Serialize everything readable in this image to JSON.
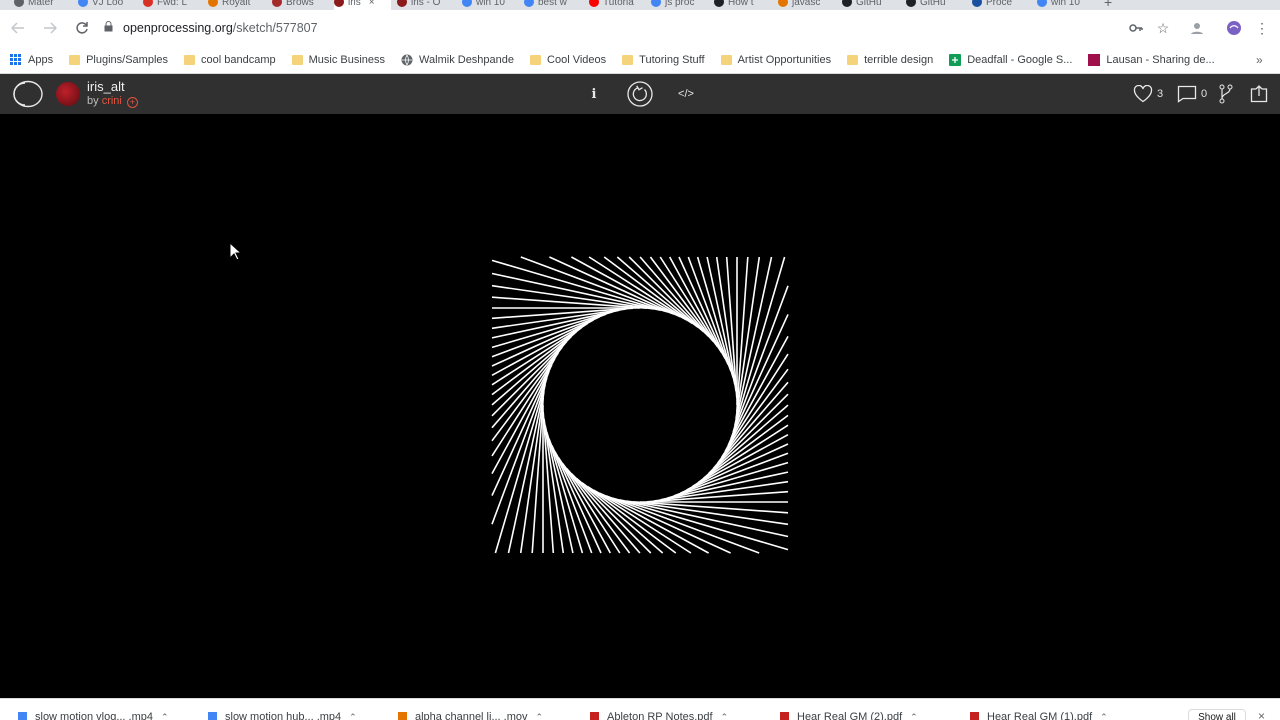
{
  "tabs": [
    {
      "title": "Mater",
      "color": "#5f6368"
    },
    {
      "title": "VJ Loo",
      "color": "#4285f4"
    },
    {
      "title": "Fwd: L",
      "color": "#d93025"
    },
    {
      "title": "Royalt",
      "color": "#e37400"
    },
    {
      "title": "Brows",
      "color": "#a52a2a"
    },
    {
      "title": "iris",
      "color": "#8b1a1a",
      "active": true,
      "close": "×"
    },
    {
      "title": "iris - O",
      "color": "#8b1a1a"
    },
    {
      "title": "win 10",
      "color": "#4285f4"
    },
    {
      "title": "best w",
      "color": "#4285f4"
    },
    {
      "title": "Tutoria",
      "color": "#ff0000"
    },
    {
      "title": "js proc",
      "color": "#4285f4"
    },
    {
      "title": "How t",
      "color": "#202124"
    },
    {
      "title": "javasc",
      "color": "#e37400"
    },
    {
      "title": "GitHu",
      "color": "#202124"
    },
    {
      "title": "GitHu",
      "color": "#202124"
    },
    {
      "title": "Proce",
      "color": "#1a4fa0"
    },
    {
      "title": "win 10",
      "color": "#4285f4"
    }
  ],
  "browser": {
    "url_host": "openprocessing.org",
    "url_path": "/sketch/577807",
    "new_tab": "+"
  },
  "bookmarks": [
    {
      "label": "Apps",
      "kind": "apps"
    },
    {
      "label": "Plugins/Samples",
      "kind": "folder"
    },
    {
      "label": "cool bandcamp",
      "kind": "folder"
    },
    {
      "label": "Music Business",
      "kind": "folder"
    },
    {
      "label": "Walmik Deshpande",
      "kind": "globe"
    },
    {
      "label": "Cool Videos",
      "kind": "folder"
    },
    {
      "label": "Tutoring Stuff",
      "kind": "folder"
    },
    {
      "label": "Artist Opportunities",
      "kind": "folder"
    },
    {
      "label": "terrible design",
      "kind": "folder"
    },
    {
      "label": "Deadfall - Google S...",
      "kind": "sheets"
    },
    {
      "label": "Lausan - Sharing de...",
      "kind": "lausan"
    }
  ],
  "bookmarks_overflow": "»",
  "sketch": {
    "title": "iris_alt",
    "by_label": "by",
    "author": "crini",
    "follow_symbol": "+",
    "info_label": "i",
    "code_label": "</>",
    "likes": "3",
    "comments": "0"
  },
  "sketch_canvas": {
    "background": "#000000",
    "stroke": "#ffffff",
    "line_count": 88
  },
  "downloads": [
    {
      "name": "slow motion vlog... .mp4",
      "color": "#4285f4"
    },
    {
      "name": "slow motion hub... .mp4",
      "color": "#4285f4"
    },
    {
      "name": "alpha channel li... .mov",
      "color": "#e37400"
    },
    {
      "name": "Ableton RP Notes.pdf",
      "color": "#c5221f"
    },
    {
      "name": "Hear Real GM (2).pdf",
      "color": "#c5221f"
    },
    {
      "name": "Hear Real GM (1).pdf",
      "color": "#c5221f"
    }
  ],
  "downloads_show_all": "Show all",
  "downloads_close": "×"
}
